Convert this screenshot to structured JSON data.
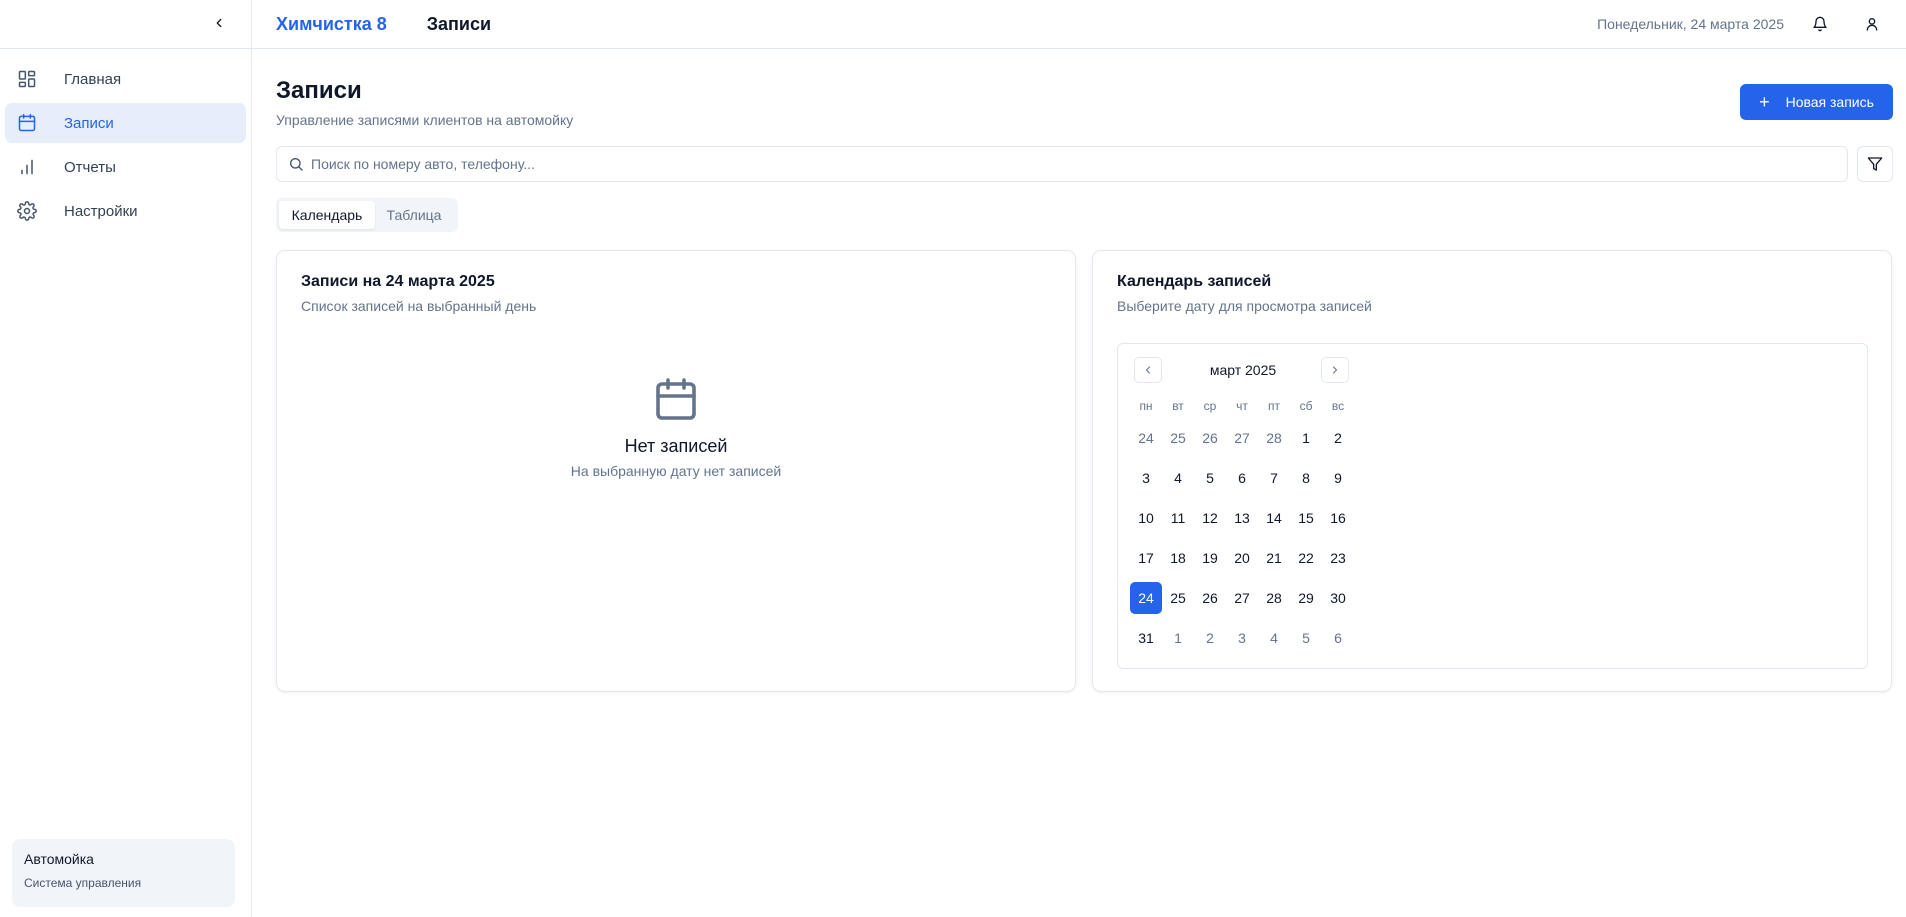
{
  "sidebar": {
    "items": [
      {
        "label": "Главная",
        "icon": "dashboard-icon"
      },
      {
        "label": "Записи",
        "icon": "calendar-icon",
        "active": true
      },
      {
        "label": "Отчеты",
        "icon": "bar-chart-icon"
      },
      {
        "label": "Настройки",
        "icon": "gear-icon"
      }
    ],
    "footer": {
      "title": "Автомойка",
      "subtitle": "Система управления"
    }
  },
  "header": {
    "brand": "Химчистка 8",
    "title": "Записи",
    "date": "Понедельник, 24 марта 2025"
  },
  "page": {
    "title": "Записи",
    "subtitle": "Управление записями клиентов на автомойку",
    "new_button": "Новая запись"
  },
  "search": {
    "placeholder": "Поиск по номеру авто, телефону...",
    "value": ""
  },
  "tabs": [
    {
      "label": "Календарь",
      "active": true
    },
    {
      "label": "Таблица",
      "active": false
    }
  ],
  "records_card": {
    "title": "Записи на 24 марта 2025",
    "subtitle": "Список записей на выбранный день",
    "empty_title": "Нет записей",
    "empty_subtitle": "На выбранную дату нет записей"
  },
  "calendar_card": {
    "title": "Календарь записей",
    "subtitle": "Выберите дату для просмотра записей",
    "month": "март 2025",
    "weekdays": [
      "пн",
      "вт",
      "ср",
      "чт",
      "пт",
      "сб",
      "вс"
    ],
    "weeks": [
      [
        "24",
        "25",
        "26",
        "27",
        "28",
        "1",
        "2"
      ],
      [
        "3",
        "4",
        "5",
        "6",
        "7",
        "8",
        "9"
      ],
      [
        "10",
        "11",
        "12",
        "13",
        "14",
        "15",
        "16"
      ],
      [
        "17",
        "18",
        "19",
        "20",
        "21",
        "22",
        "23"
      ],
      [
        "24",
        "25",
        "26",
        "27",
        "28",
        "29",
        "30"
      ],
      [
        "31",
        "1",
        "2",
        "3",
        "4",
        "5",
        "6"
      ]
    ],
    "selected": "24"
  },
  "colors": {
    "accent": "#2563eb",
    "muted": "#64748b",
    "border": "#e2e8f0"
  }
}
